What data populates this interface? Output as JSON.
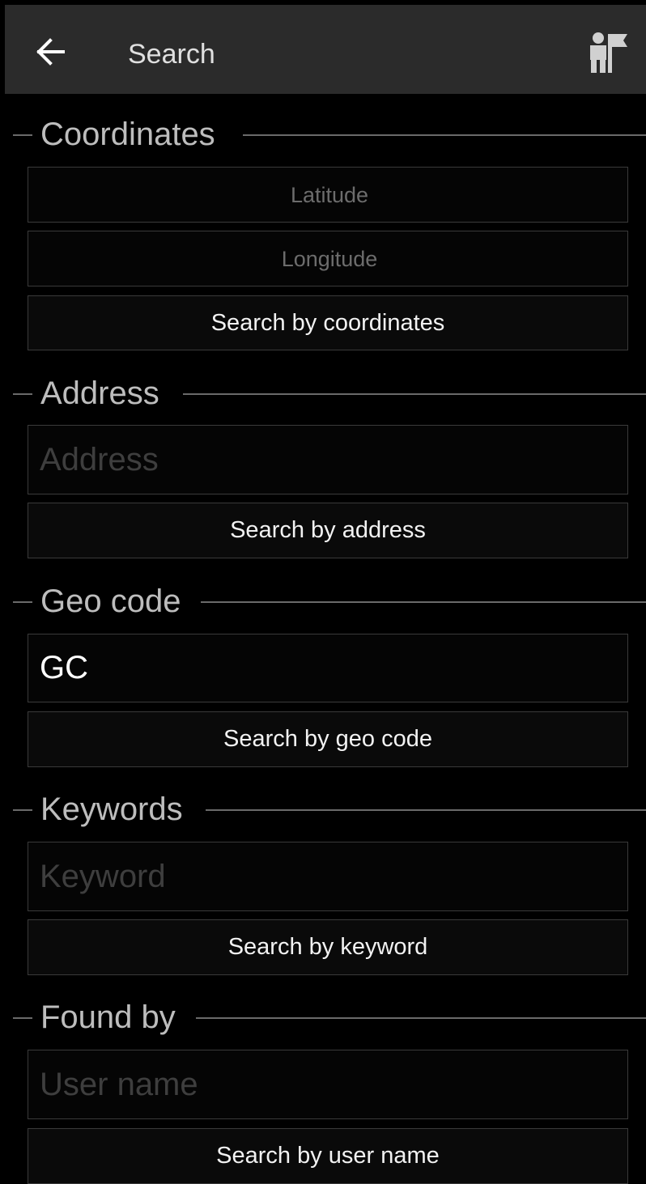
{
  "toolbar": {
    "title": "Search",
    "back_icon": "arrow-left-icon",
    "action_icon": "geocacher-flag-icon"
  },
  "coordinates": {
    "heading": "Coordinates",
    "latitude_placeholder": "Latitude",
    "longitude_placeholder": "Longitude",
    "button_label": "Search by coordinates"
  },
  "address": {
    "heading": "Address",
    "placeholder": "Address",
    "button_label": "Search by address"
  },
  "geocode": {
    "heading": "Geo code",
    "value": "GC",
    "button_label": "Search by geo code"
  },
  "keywords": {
    "heading": "Keywords",
    "placeholder": "Keyword",
    "button_label": "Search by keyword"
  },
  "found_by": {
    "heading": "Found by",
    "placeholder": "User name",
    "button_label": "Search by user name"
  }
}
